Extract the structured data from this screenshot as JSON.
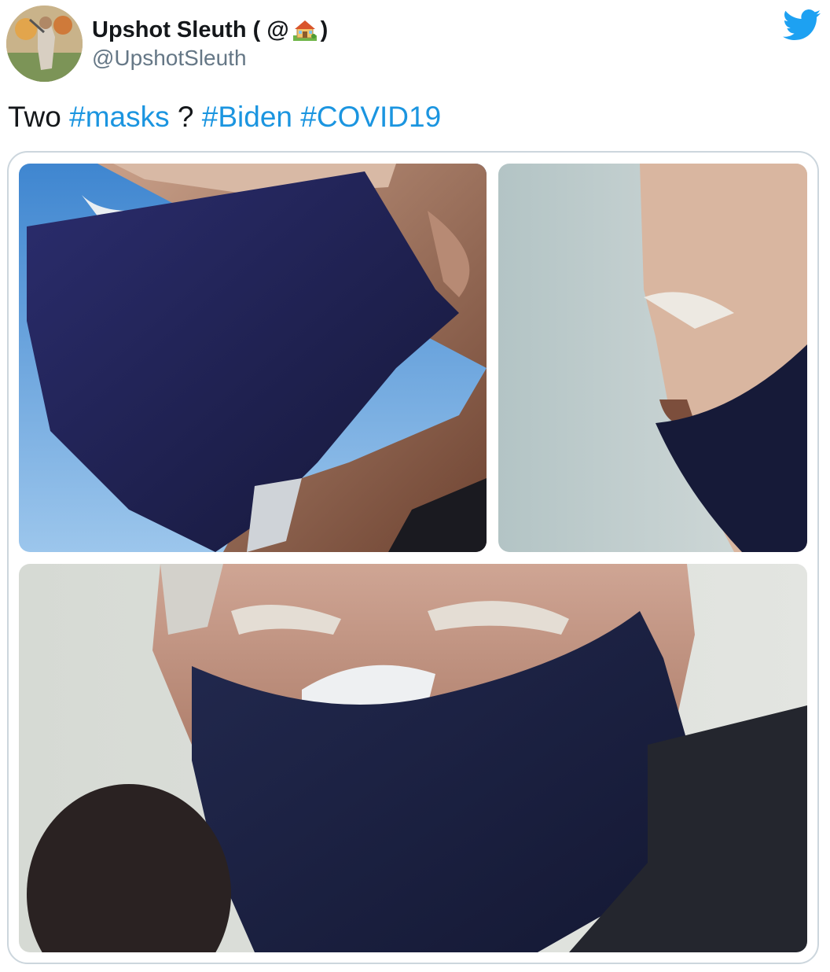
{
  "tweet": {
    "display_name_prefix": "Upshot Sleuth ( @",
    "display_name_emoji": "house-with-garden-icon",
    "display_name_suffix": ")",
    "handle": "@UpshotSleuth",
    "text_segments": [
      {
        "text": "Two ",
        "type": "plain"
      },
      {
        "text": "#masks",
        "type": "hashtag"
      },
      {
        "text": " ? ",
        "type": "plain"
      },
      {
        "text": "#Biden",
        "type": "hashtag"
      },
      {
        "text": " ",
        "type": "plain"
      },
      {
        "text": "#COVID19",
        "type": "hashtag"
      }
    ],
    "photos": [
      {
        "name": "photo-masks-closeup-left",
        "icon": "photo"
      },
      {
        "name": "photo-masks-profile-right",
        "icon": "photo"
      },
      {
        "name": "photo-masks-front-bottom",
        "icon": "photo"
      }
    ]
  },
  "colors": {
    "text": "#14171a",
    "secondary": "#657786",
    "link": "#1b95e0",
    "twitter_blue": "#1da1f2",
    "border": "#ccd6dd",
    "mask": "#1a1f48"
  }
}
